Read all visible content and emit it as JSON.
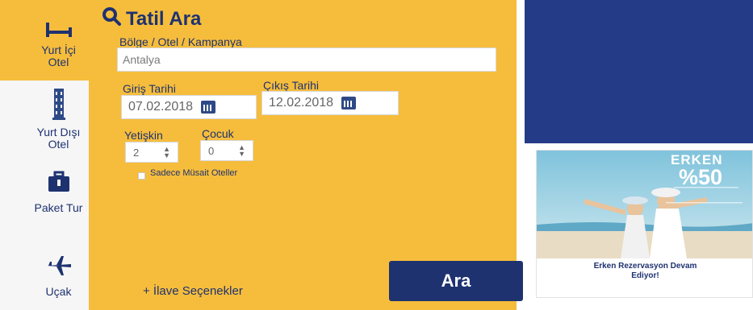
{
  "tabs": [
    {
      "label": "Yurt İçi\nOtel",
      "icon": "bed-icon",
      "active": true
    },
    {
      "label": "Yurt Dışı\nOtel",
      "icon": "tower-icon",
      "active": false
    },
    {
      "label": "Paket Tur",
      "icon": "suitcase-icon",
      "active": false
    },
    {
      "label": "Uçak",
      "icon": "airplane-icon",
      "active": false
    }
  ],
  "form": {
    "title": "Tatil Ara",
    "location_label": "Bölge / Otel / Kampanya",
    "location_value": "Antalya",
    "checkin_label": "Giriş Tarihi",
    "checkin_value": "07.02.2018",
    "checkout_label": "Çıkış Tarihi",
    "checkout_value": "12.02.2018",
    "adults_label": "Yetişkin",
    "adults_value": "2",
    "children_label": "Çocuk",
    "children_value": "0",
    "available_only_label": "Sadece Müsait Oteller",
    "more_options": "+ İlave Seçenekler",
    "search_button": "Ara"
  },
  "promo": {
    "headline": "ERKEN",
    "percent": "%50",
    "caption": "Erken Rezervasyon Devam\nEdiyor!"
  },
  "colors": {
    "panel": "#f6bd3c",
    "navy": "#1e3270",
    "banner": "#243c87"
  }
}
